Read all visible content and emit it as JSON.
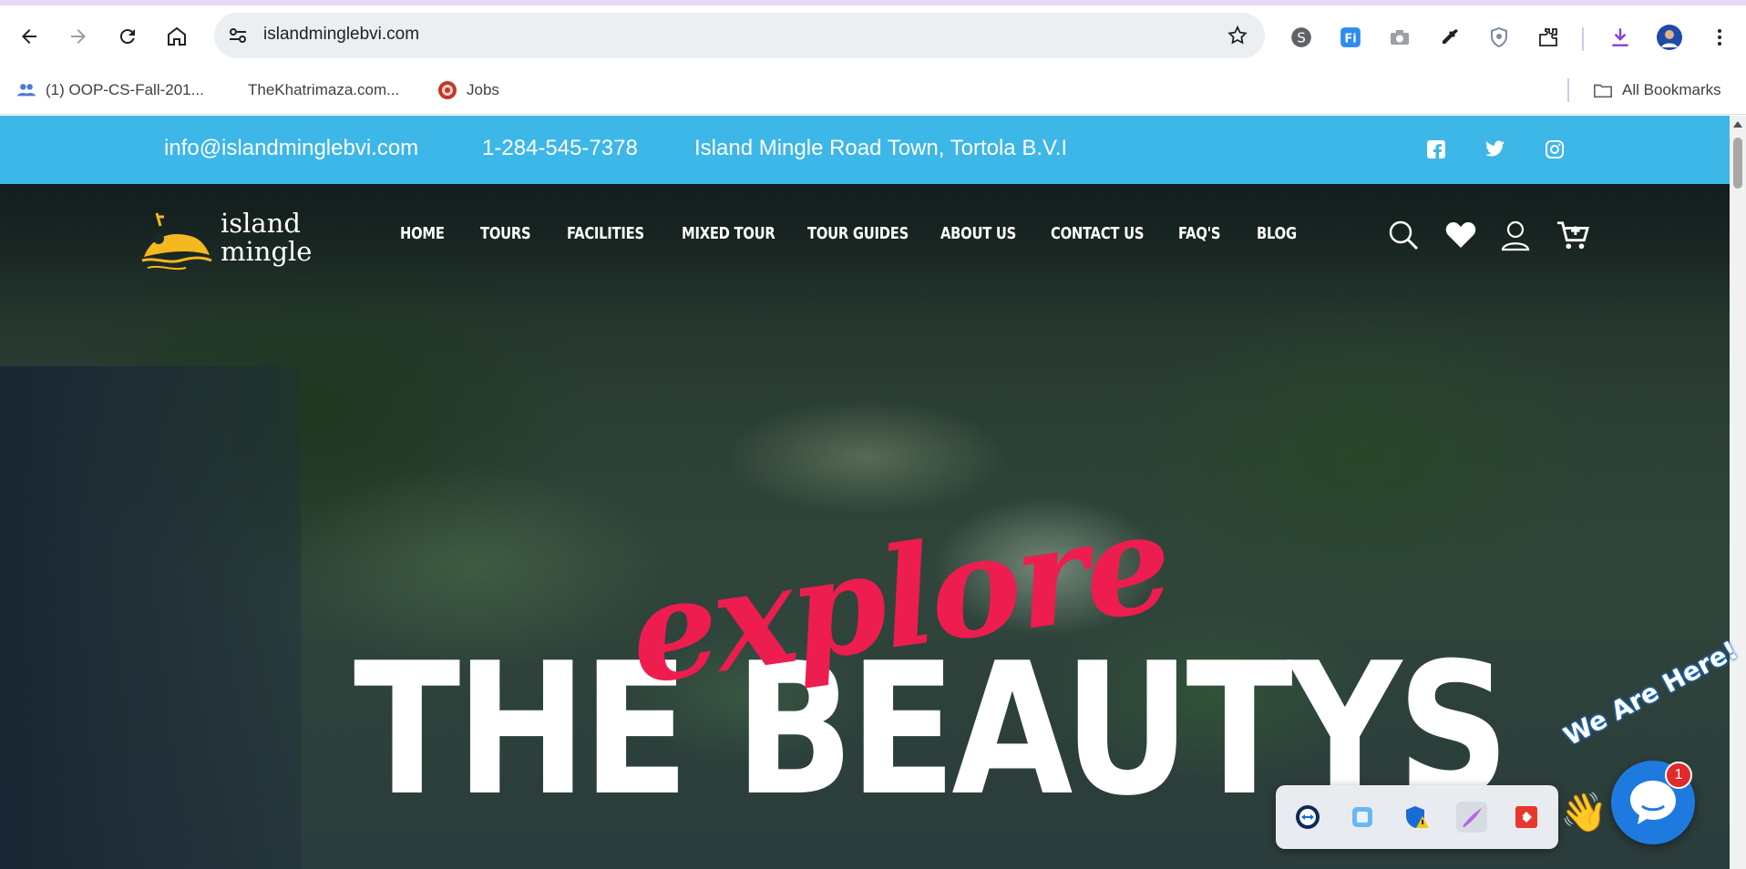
{
  "browser": {
    "url": "islandminglebvi.com",
    "bookmarks": [
      {
        "label": "(1) OOP-CS-Fall-201...",
        "icon": "people-icon"
      },
      {
        "label": "TheKhatrimaza.com...",
        "icon": "blank-page-icon"
      },
      {
        "label": "Jobs",
        "icon": "jobs-favicon"
      }
    ],
    "all_bookmarks_label": "All Bookmarks"
  },
  "site": {
    "topbar": {
      "email": "info@islandminglebvi.com",
      "phone": "1-284-545-7378",
      "address": "Island Mingle Road Town, Tortola B.V.I"
    },
    "logo": {
      "line1": "island",
      "line2": "mingle"
    },
    "nav": [
      "HOME",
      "TOURS",
      "FACILITIES",
      "MIXED TOUR",
      "TOUR GUIDES",
      "ABOUT US",
      "CONTACT US",
      "FAQ'S",
      "BLOG"
    ],
    "hero": {
      "script_text": "explore",
      "headline": "THE BEAUTYS"
    },
    "chat": {
      "label": "We Are Here!",
      "badge": "1"
    }
  },
  "colors": {
    "topbar": "#3db6e8",
    "script": "#ee1d4f",
    "logo_accent": "#f5b820",
    "chat": "#1f7ae0"
  }
}
